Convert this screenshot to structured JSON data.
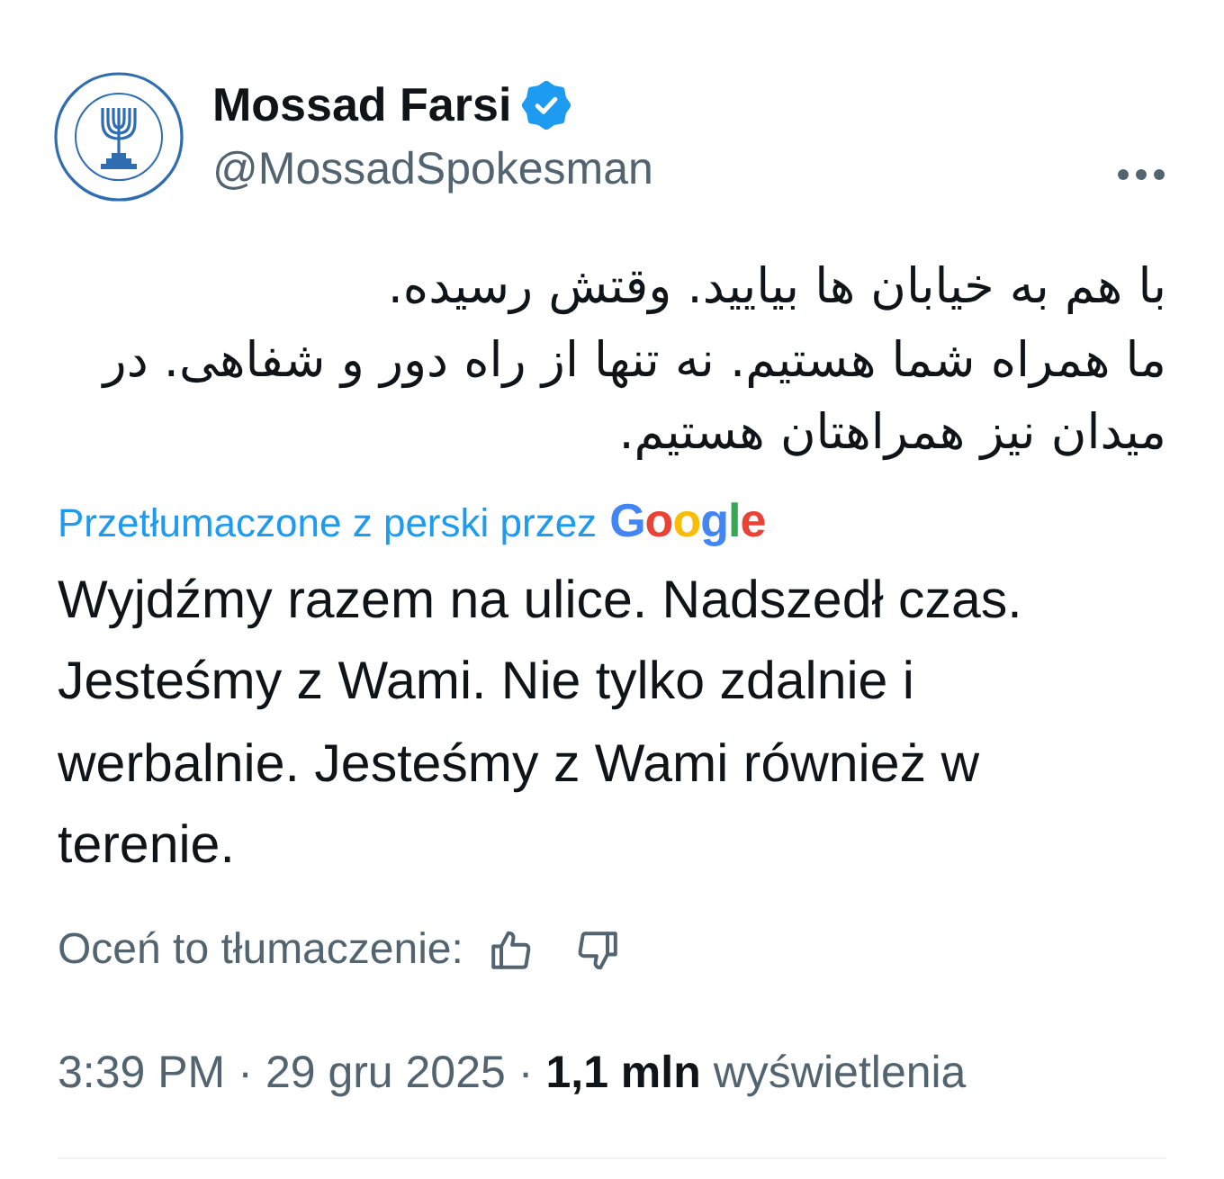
{
  "author": {
    "name": "Mossad Farsi",
    "verified": true,
    "handle": "@MossadSpokesman"
  },
  "post": {
    "text": "با هم به خیابان ها بیایید. وقتش رسیده.\nما همراه شما هستیم. نه تنها از راه دور و شفاهی. در میدان نیز همراهتان هستیم.",
    "translation_note": {
      "label": "Przetłumaczone z perski przez",
      "provider": "Google"
    },
    "translation": "Wyjdźmy razem na ulice. Nadszedł czas. Jesteśmy z Wami. Nie tylko zdalnie i werbalnie. Jesteśmy z Wami również w terenie.",
    "rating": {
      "label": "Oceń to tłumaczenie:"
    }
  },
  "meta": {
    "time": "3:39 PM",
    "separator_1": "·",
    "date": "29 gru 2025",
    "separator_2": "·",
    "views_count": "1,1 mln",
    "views_label": "wyświetlenia"
  }
}
